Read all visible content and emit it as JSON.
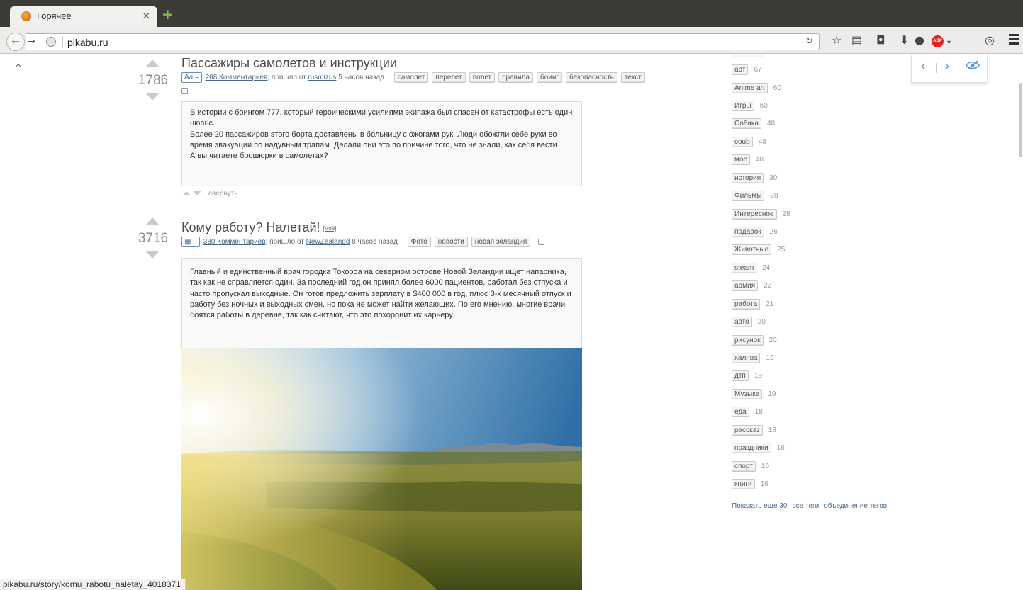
{
  "browser": {
    "tab_title": "Горячее",
    "url": "pikabu.ru",
    "status_url": "pikabu.ru/story/komu_rabotu_naletay_4018371",
    "abp_label": "ABP"
  },
  "stories": [
    {
      "rating": "1786",
      "title": "Пассажиры самолетов и инструкции",
      "type_badge": "Aa –",
      "comments_link": "268 Комментариев",
      "from_prefix": "; пришло от",
      "author": "rusmizus",
      "time": "5 часов назад",
      "tags": [
        "самолет",
        "перелет",
        "полет",
        "правила",
        "боинг",
        "безопасность",
        "текст"
      ],
      "paragraphs": [
        "В истории с боингом 777, который героическими усилиями экипажа был спасен от катастрофы есть один нюанс.",
        "Более 20 пассажиров этого борта доставлены в больницу с ожогами рук. Люди обожгли себе руки во время эвакуации по надувным трапам. Делали они это по причине того, что не знали, как себя вести.",
        "А вы читаете брошюрки в самолетах?"
      ],
      "collapse_label": "свернуть"
    },
    {
      "rating": "3716",
      "title": "Кому работу? Налетай!",
      "own_label": "[моё]",
      "type_badge": "▦ –",
      "comments_link": "380 Комментариев",
      "from_prefix": "; пришло от",
      "author": "NewZealandd",
      "time": "8 часов назад",
      "tags": [
        "Фото",
        "новости",
        "новая зеландия"
      ],
      "paragraphs": [
        "Главный и единственный врач городка Токороа на северном острове Новой Зеландии ищет напарника, так как не справляется один. За последний год он принял более 6000 пациентов, работал без отпуска и часто пропускал выходные. Он готов предложить зарплату в $400 000 в год, плюс 3-х месячный отпуск и работу без ночных и выходных смен, но пока не может найти желающих. По его мнению, многие врачи боятся работы в деревне, так как считают, что это похоронит их карьеру."
      ]
    }
  ],
  "sidebar": {
    "tags": [
      {
        "name": "арт",
        "count": "67"
      },
      {
        "name": "Anime art",
        "count": "60"
      },
      {
        "name": "Игры",
        "count": "50"
      },
      {
        "name": "Собака",
        "count": "48"
      },
      {
        "name": "coub",
        "count": "48"
      },
      {
        "name": "моё",
        "count": "48"
      },
      {
        "name": "история",
        "count": "30"
      },
      {
        "name": "Фильмы",
        "count": "28"
      },
      {
        "name": "Интересное",
        "count": "28"
      },
      {
        "name": "подарок",
        "count": "26"
      },
      {
        "name": "Животные",
        "count": "25"
      },
      {
        "name": "steam",
        "count": "24"
      },
      {
        "name": "армия",
        "count": "22"
      },
      {
        "name": "работа",
        "count": "21"
      },
      {
        "name": "авто",
        "count": "20"
      },
      {
        "name": "рисунок",
        "count": "20"
      },
      {
        "name": "халява",
        "count": "19"
      },
      {
        "name": "дтп",
        "count": "19"
      },
      {
        "name": "Музыка",
        "count": "19"
      },
      {
        "name": "еда",
        "count": "18"
      },
      {
        "name": "рассказ",
        "count": "18"
      },
      {
        "name": "праздники",
        "count": "16"
      },
      {
        "name": "спорт",
        "count": "16"
      },
      {
        "name": "книги",
        "count": "16"
      }
    ],
    "show_more": "Показать еще 30",
    "all_tags": "все теги",
    "merge_tags": "объединение тегов"
  },
  "colors": {
    "accent_link": "#4a6a8a",
    "vote_arrow": "#c9cacc",
    "nav_arrow": "#5a9ad6"
  }
}
